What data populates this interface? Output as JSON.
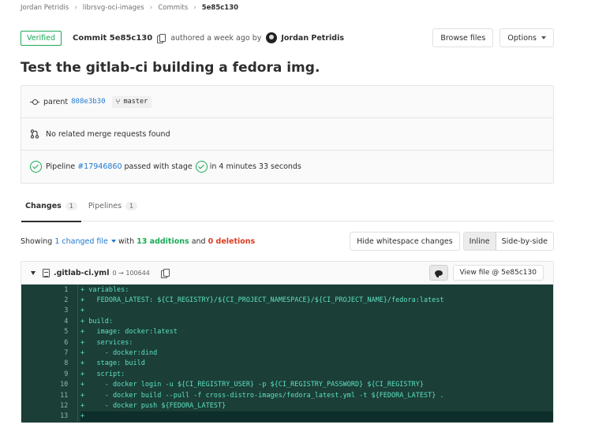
{
  "breadcrumb": {
    "items": [
      "Jordan Petridis",
      "librsvg-oci-images",
      "Commits",
      "5e85c130"
    ]
  },
  "commit": {
    "verified_label": "Verified",
    "title_prefix": "Commit 5e85c130",
    "authored_text": "authored a week ago by",
    "author": "Jordan Petridis",
    "browse_files_label": "Browse files",
    "options_label": "Options",
    "message": "Test the gitlab-ci building a fedora img."
  },
  "info": {
    "parent_label": "parent",
    "parent_sha": "808e3b30",
    "branch": "master",
    "merge_requests_text": "No related merge requests found",
    "pipeline_label": "Pipeline",
    "pipeline_id": "#17946860",
    "pipeline_status_text": "passed with stage",
    "pipeline_duration": "in 4 minutes 33 seconds"
  },
  "tabs": [
    {
      "label": "Changes",
      "count": "1"
    },
    {
      "label": "Pipelines",
      "count": "1"
    }
  ],
  "changes": {
    "showing": "Showing",
    "changed_files": "1 changed file",
    "with": "with",
    "additions": "13 additions",
    "and": "and",
    "deletions": "0 deletions",
    "hide_whitespace_label": "Hide whitespace changes",
    "inline_label": "Inline",
    "side_by_side_label": "Side-by-side"
  },
  "file": {
    "name": ".gitlab-ci.yml",
    "mode": "0 → 100644",
    "view_file_label": "View file @ 5e85c130"
  },
  "code_lines": [
    {
      "num": "1",
      "text": "+ variables:"
    },
    {
      "num": "2",
      "text": "+   FEDORA_LATEST: ${CI_REGISTRY}/${CI_PROJECT_NAMESPACE}/${CI_PROJECT_NAME}/fedora:latest"
    },
    {
      "num": "3",
      "text": "+"
    },
    {
      "num": "4",
      "text": "+ build:"
    },
    {
      "num": "5",
      "text": "+   image: docker:latest"
    },
    {
      "num": "6",
      "text": "+   services:"
    },
    {
      "num": "7",
      "text": "+     - docker:dind"
    },
    {
      "num": "8",
      "text": "+   stage: build"
    },
    {
      "num": "9",
      "text": "+   script:"
    },
    {
      "num": "10",
      "text": "+     - docker login -u ${CI_REGISTRY_USER} -p ${CI_REGISTRY_PASSWORD} ${CI_REGISTRY}"
    },
    {
      "num": "11",
      "text": "+     - docker build --pull -f cross-distro-images/fedora_latest.yml -t ${FEDORA_LATEST} ."
    },
    {
      "num": "12",
      "text": "+     - docker push ${FEDORA_LATEST}"
    },
    {
      "num": "13",
      "text": "+"
    }
  ],
  "colors": {
    "verified_green": "#1aaa55",
    "link_blue": "#1f78d1",
    "deletion_red": "#db3b21",
    "diff_background": "#1b3e37",
    "diff_text": "#5de0c0"
  }
}
